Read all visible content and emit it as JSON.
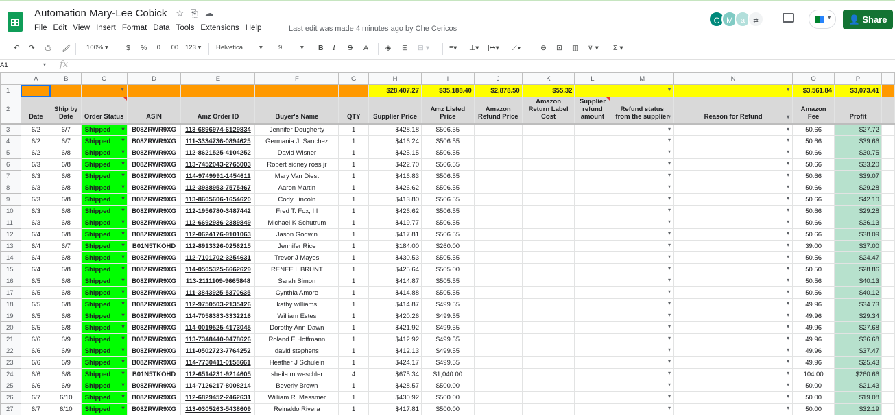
{
  "header": {
    "title": "Automation Mary-Lee Cobick",
    "menu": [
      "File",
      "Edit",
      "View",
      "Insert",
      "Format",
      "Data",
      "Tools",
      "Extensions",
      "Help"
    ],
    "last_edit": "Last edit was made 4 minutes ago by Che Cericos",
    "avatars": [
      "C",
      "M",
      "a"
    ],
    "share_label": "Share",
    "accent": "#137333"
  },
  "toolbar": {
    "zoom": "100%",
    "currency": "$",
    "percent": "%",
    "dec_less": ".0",
    "dec_more": ".00",
    "format_more": "123",
    "font": "Helvetica",
    "font_size": "9"
  },
  "formula_bar": {
    "cell_ref": "A1",
    "fx": "fx"
  },
  "grid": {
    "columns": [
      "A",
      "B",
      "C",
      "D",
      "E",
      "F",
      "G",
      "H",
      "I",
      "J",
      "K",
      "L",
      "M",
      "N",
      "O",
      "P"
    ],
    "totals": {
      "H": "$28,407.27",
      "I": "$35,188.40",
      "J": "$2,878.50",
      "K": "$55.32",
      "O": "$3,561.84",
      "P": "$3,073.41"
    },
    "headers": [
      "Date",
      "Ship by Date",
      "Order Status",
      "ASIN",
      "Amz Order ID",
      "Buyer's Name",
      "QTY",
      "Supplier Price",
      "Amz Listed Price",
      "Amazon Refund Price",
      "Amazon Return Label Cost",
      "Supplier refund amount",
      "Refund status from the supplier",
      "Reason for Refund",
      "Amazon Fee",
      "Profit"
    ],
    "rows": [
      {
        "n": "3",
        "date": "6/2",
        "ship": "6/7",
        "status": "Shipped",
        "asin": "B08ZRWR9XG",
        "order": "113-6896974-6129834",
        "buyer": "Jennifer Dougherty",
        "qty": "1",
        "sup": "$428.18",
        "list": "$506.55",
        "fee": "50.66",
        "profit": "$27.72"
      },
      {
        "n": "4",
        "date": "6/2",
        "ship": "6/7",
        "status": "Shipped",
        "asin": "B08ZRWR9XG",
        "order": "111-3334736-0894625",
        "buyer": "Germania J. Sanchez",
        "qty": "1",
        "sup": "$416.24",
        "list": "$506.55",
        "fee": "50.66",
        "profit": "$39.66"
      },
      {
        "n": "5",
        "date": "6/2",
        "ship": "6/8",
        "status": "Shipped",
        "asin": "B08ZRWR9XG",
        "order": "112-8621525-4104252",
        "buyer": "David Wisner",
        "qty": "1",
        "sup": "$425.15",
        "list": "$506.55",
        "fee": "50.66",
        "profit": "$30.75"
      },
      {
        "n": "6",
        "date": "6/3",
        "ship": "6/8",
        "status": "Shipped",
        "asin": "B08ZRWR9XG",
        "order": "113-7452043-2765003",
        "buyer": "Robert sidney ross jr",
        "qty": "1",
        "sup": "$422.70",
        "list": "$506.55",
        "fee": "50.66",
        "profit": "$33.20"
      },
      {
        "n": "7",
        "date": "6/3",
        "ship": "6/8",
        "status": "Shipped",
        "asin": "B08ZRWR9XG",
        "order": "114-9749991-1454611",
        "buyer": "Mary Van Diest",
        "qty": "1",
        "sup": "$416.83",
        "list": "$506.55",
        "fee": "50.66",
        "profit": "$39.07"
      },
      {
        "n": "8",
        "date": "6/3",
        "ship": "6/8",
        "status": "Shipped",
        "asin": "B08ZRWR9XG",
        "order": "112-3938953-7575467",
        "buyer": "Aaron Martin",
        "qty": "1",
        "sup": "$426.62",
        "list": "$506.55",
        "fee": "50.66",
        "profit": "$29.28"
      },
      {
        "n": "9",
        "date": "6/3",
        "ship": "6/8",
        "status": "Shipped",
        "asin": "B08ZRWR9XG",
        "order": "113-8605606-1654620",
        "buyer": "Cody Lincoln",
        "qty": "1",
        "sup": "$413.80",
        "list": "$506.55",
        "fee": "50.66",
        "profit": "$42.10"
      },
      {
        "n": "10",
        "date": "6/3",
        "ship": "6/8",
        "status": "Shipped",
        "asin": "B08ZRWR9XG",
        "order": "112-1956780-3487442",
        "buyer": "Fred T. Fox, III",
        "qty": "1",
        "sup": "$426.62",
        "list": "$506.55",
        "fee": "50.66",
        "profit": "$29.28"
      },
      {
        "n": "11",
        "date": "6/3",
        "ship": "6/8",
        "status": "Shipped",
        "asin": "B08ZRWR9XG",
        "order": "112-6692936-2389849",
        "buyer": "Michael K Schutrum",
        "qty": "1",
        "sup": "$419.77",
        "list": "$506.55",
        "fee": "50.66",
        "profit": "$36.13"
      },
      {
        "n": "12",
        "date": "6/4",
        "ship": "6/8",
        "status": "Shipped",
        "asin": "B08ZRWR9XG",
        "order": "112-0624176-9101063",
        "buyer": "Jason Godwin",
        "qty": "1",
        "sup": "$417.81",
        "list": "$506.55",
        "fee": "50.66",
        "profit": "$38.09"
      },
      {
        "n": "13",
        "date": "6/4",
        "ship": "6/7",
        "status": "Shipped",
        "asin": "B01N5TKOHD",
        "order": "112-8913326-0256215",
        "buyer": "Jennifer Rice",
        "qty": "1",
        "sup": "$184.00",
        "list": "$260.00",
        "fee": "39.00",
        "profit": "$37.00"
      },
      {
        "n": "14",
        "date": "6/4",
        "ship": "6/8",
        "status": "Shipped",
        "asin": "B08ZRWR9XG",
        "order": "112-7101702-3254631",
        "buyer": "Trevor J Mayes",
        "qty": "1",
        "sup": "$430.53",
        "list": "$505.55",
        "fee": "50.56",
        "profit": "$24.47"
      },
      {
        "n": "15",
        "date": "6/4",
        "ship": "6/8",
        "status": "Shipped",
        "asin": "B08ZRWR9XG",
        "order": "114-0505325-6662629",
        "buyer": "RENEE L BRUNT",
        "qty": "1",
        "sup": "$425.64",
        "list": "$505.00",
        "fee": "50.50",
        "profit": "$28.86"
      },
      {
        "n": "16",
        "date": "6/5",
        "ship": "6/8",
        "status": "Shipped",
        "asin": "B08ZRWR9XG",
        "order": "113-2111109-9665848",
        "buyer": "Sarah Simon",
        "qty": "1",
        "sup": "$414.87",
        "list": "$505.55",
        "fee": "50.56",
        "profit": "$40.13"
      },
      {
        "n": "17",
        "date": "6/5",
        "ship": "6/8",
        "status": "Shipped",
        "asin": "B08ZRWR9XG",
        "order": "111-3843925-5370635",
        "buyer": "Cynthia Amore",
        "qty": "1",
        "sup": "$414.88",
        "list": "$505.55",
        "fee": "50.56",
        "profit": "$40.12"
      },
      {
        "n": "18",
        "date": "6/5",
        "ship": "6/8",
        "status": "Shipped",
        "asin": "B08ZRWR9XG",
        "order": "112-9750503-2135426",
        "buyer": "kathy williams",
        "qty": "1",
        "sup": "$414.87",
        "list": "$499.55",
        "fee": "49.96",
        "profit": "$34.73"
      },
      {
        "n": "19",
        "date": "6/5",
        "ship": "6/8",
        "status": "Shipped",
        "asin": "B08ZRWR9XG",
        "order": "114-7058383-3332216",
        "buyer": "William Estes",
        "qty": "1",
        "sup": "$420.26",
        "list": "$499.55",
        "fee": "49.96",
        "profit": "$29.34"
      },
      {
        "n": "20",
        "date": "6/5",
        "ship": "6/8",
        "status": "Shipped",
        "asin": "B08ZRWR9XG",
        "order": "114-0019525-4173045",
        "buyer": "Dorothy Ann Dawn",
        "qty": "1",
        "sup": "$421.92",
        "list": "$499.55",
        "fee": "49.96",
        "profit": "$27.68"
      },
      {
        "n": "21",
        "date": "6/6",
        "ship": "6/9",
        "status": "Shipped",
        "asin": "B08ZRWR9XG",
        "order": "113-7348440-9478626",
        "buyer": "Roland E Hoffmann",
        "qty": "1",
        "sup": "$412.92",
        "list": "$499.55",
        "fee": "49.96",
        "profit": "$36.68"
      },
      {
        "n": "22",
        "date": "6/6",
        "ship": "6/9",
        "status": "Shipped",
        "asin": "B08ZRWR9XG",
        "order": "111-0502723-7764252",
        "buyer": "david stephens",
        "qty": "1",
        "sup": "$412.13",
        "list": "$499.55",
        "fee": "49.96",
        "profit": "$37.47"
      },
      {
        "n": "23",
        "date": "6/6",
        "ship": "6/9",
        "status": "Shipped",
        "asin": "B08ZRWR9XG",
        "order": "114-7730411-0158661",
        "buyer": "Heather J Schulein",
        "qty": "1",
        "sup": "$424.17",
        "list": "$499.55",
        "fee": "49.96",
        "profit": "$25.43"
      },
      {
        "n": "24",
        "date": "6/6",
        "ship": "6/8",
        "status": "Shipped",
        "asin": "B01N5TKOHD",
        "order": "112-6514231-9214605",
        "buyer": "sheila m weschler",
        "qty": "4",
        "sup": "$675.34",
        "list": "$1,040.00",
        "fee": "104.00",
        "profit": "$260.66"
      },
      {
        "n": "25",
        "date": "6/6",
        "ship": "6/9",
        "status": "Shipped",
        "asin": "B08ZRWR9XG",
        "order": "114-7126217-8008214",
        "buyer": "Beverly Brown",
        "qty": "1",
        "sup": "$428.57",
        "list": "$500.00",
        "fee": "50.00",
        "profit": "$21.43"
      },
      {
        "n": "26",
        "date": "6/7",
        "ship": "6/10",
        "status": "Shipped",
        "asin": "B08ZRWR9XG",
        "order": "112-6829452-2462631",
        "buyer": "William R. Messmer",
        "qty": "1",
        "sup": "$430.92",
        "list": "$500.00",
        "fee": "50.00",
        "profit": "$19.08"
      },
      {
        "n": "27",
        "date": "6/7",
        "ship": "6/10",
        "status": "Shipped",
        "asin": "B08ZRWR9XG",
        "order": "113-0305263-5438609",
        "buyer": "Reinaldo Rivera",
        "qty": "1",
        "sup": "$417.81",
        "list": "$500.00",
        "fee": "50.00",
        "profit": "$32.19"
      }
    ]
  }
}
